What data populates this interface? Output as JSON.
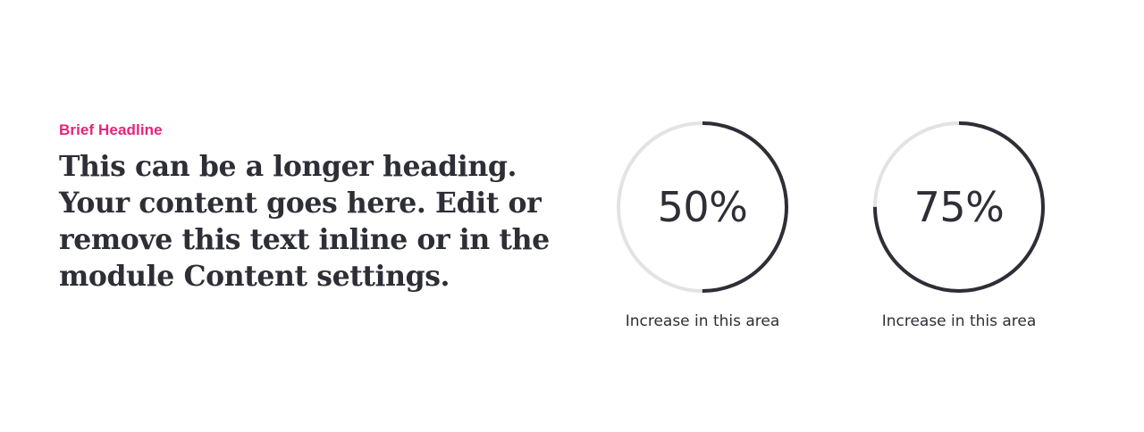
{
  "colors": {
    "accent": "#e8237a",
    "text": "#2e2e36",
    "ring_track": "#e3e3e3",
    "ring_progress": "#2e2e36",
    "background": "#ffffff"
  },
  "intro": {
    "eyebrow": "Brief Headline",
    "heading": "This can be a longer heading. Your content goes here. Edit or remove this text inline or in the module Content settings."
  },
  "stats": [
    {
      "value_label": "50%",
      "progress": 0.5,
      "caption": "Increase in this area"
    },
    {
      "value_label": "75%",
      "progress": 0.75,
      "caption": "Increase in this area"
    }
  ]
}
